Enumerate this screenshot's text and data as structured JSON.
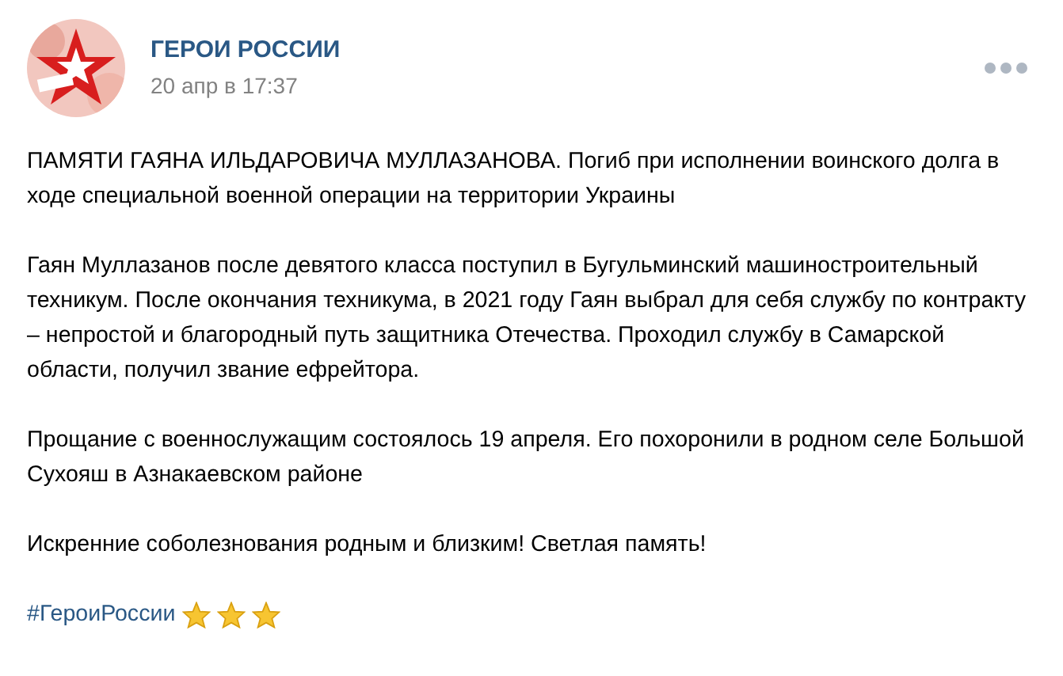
{
  "post": {
    "author": "ГЕРОИ РОССИИ",
    "date": "20 апр в 17:37",
    "paragraphs": [
      "ПАМЯТИ ГАЯНА ИЛЬДАРОВИЧА МУЛЛАЗАНОВА. Погиб при исполнении воинского долга в ходе специальной военной операции на территории Украины",
      "Гаян Муллазанов после девятого класса поступил в Бугульминский машиностроительный техникум. После окончания техникума, в 2021 году Гаян выбрал для себя службу по контракту – непростой и благородный путь защитника Отечества. Проходил службу в Самарской области, получил звание ефрейтора.",
      "Прощание с военнослужащим состоялось 19 апреля. Его похоронили в родном селе Большой Сухояш в Азнакаевском районе",
      "Искренние соболезнования родным и близким! Светлая память!"
    ],
    "hashtag": "#ГероиРоссии"
  }
}
